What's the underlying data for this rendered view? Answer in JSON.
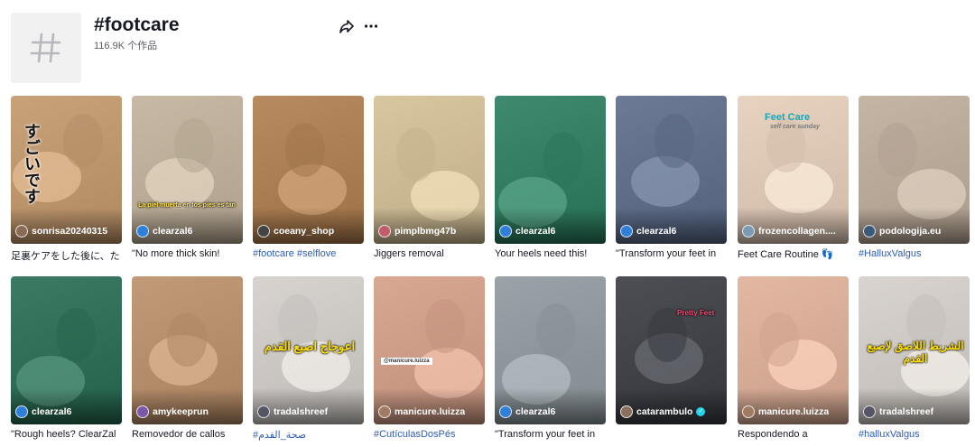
{
  "header": {
    "title": "#footcare",
    "subtitle": "116.9K 个作品"
  },
  "videos": [
    {
      "author": "sonrisa20240315",
      "caption": "足裏ケアをした後に、た",
      "caption_is_tag": false,
      "overlay_text": "すごいです",
      "bg": "#c9a27a",
      "av_color": "#8a6b55"
    },
    {
      "author": "clearzal6",
      "caption": "\"No more thick skin!",
      "caption_is_tag": false,
      "overlay_text": "La piel muerta en los pies es tan",
      "bg": "#c7b9a4",
      "av_color": "#2f7fd8",
      "verified": false
    },
    {
      "author": "coeany_shop",
      "caption": "#footcare #selflove",
      "caption_is_tag": true,
      "overlay_text": "",
      "bg": "#b78a5f",
      "av_color": "#444"
    },
    {
      "author": "pimplbmg47b",
      "caption": "Jiggers removal",
      "caption_is_tag": false,
      "overlay_text": "",
      "bg": "#d8c6a0",
      "av_color": "#c05d6b"
    },
    {
      "author": "clearzal6",
      "caption": "Your heels need this!",
      "caption_is_tag": false,
      "overlay_text": "",
      "bg": "#3f8a6f",
      "av_color": "#2f7fd8"
    },
    {
      "author": "clearzal6",
      "caption": "\"Transform your feet in",
      "caption_is_tag": false,
      "overlay_text": "",
      "bg": "#6c7a96",
      "av_color": "#2f7fd8"
    },
    {
      "author": "frozencollagen....",
      "caption": "Feet Care Routine 👣",
      "caption_is_tag": false,
      "overlay_text": "Feet Care",
      "overlay_sub": "self care sunday",
      "bg": "#e8d2c0",
      "av_color": "#7b9bb3"
    },
    {
      "author": "podologija.eu",
      "caption": "#HalluxValgus",
      "caption_is_tag": true,
      "overlay_text": "",
      "bg": "#c5b5a5",
      "av_color": "#3b5a7a"
    },
    {
      "author": "clearzal6",
      "caption": "\"Rough heels? ClearZal",
      "caption_is_tag": false,
      "overlay_text": "",
      "bg": "#3c7a63",
      "av_color": "#2f7fd8"
    },
    {
      "author": "amykeeprun",
      "caption": "Removedor de callos",
      "caption_is_tag": false,
      "overlay_text": "",
      "bg": "#c29a78",
      "av_color": "#7a5aa8"
    },
    {
      "author": "tradalshreef",
      "caption": "#صحة_القدم",
      "caption_is_tag": true,
      "overlay_text": "اعوجاج اصبع القدم",
      "bg": "#d7d3cf",
      "av_color": "#556"
    },
    {
      "author": "manicure.luizza",
      "caption": "#CutículasDosPés",
      "caption_is_tag": true,
      "overlay_text": "@manicure.luizza",
      "bg": "#d9a893",
      "av_color": "#a07a62"
    },
    {
      "author": "clearzal6",
      "caption": "\"Transform your feet in",
      "caption_is_tag": false,
      "overlay_text": "",
      "bg": "#9aa3a8",
      "av_color": "#2f7fd8"
    },
    {
      "author": "catarambulo",
      "caption": "",
      "caption_is_tag": false,
      "overlay_text": "Pretty Feet",
      "bg": "#4d4f55",
      "av_color": "#8b6f5e",
      "verified": true
    },
    {
      "author": "manicure.luizza",
      "caption": "Respondendo a",
      "caption_is_tag": false,
      "overlay_text": "",
      "bg": "#e3b8a2",
      "av_color": "#a07a62"
    },
    {
      "author": "tradalshreef",
      "caption": "#halluxValgus",
      "caption_is_tag": true,
      "overlay_text": "الشريط اللاصق لإصبع القدم",
      "bg": "#d9d4cf",
      "av_color": "#556"
    }
  ]
}
